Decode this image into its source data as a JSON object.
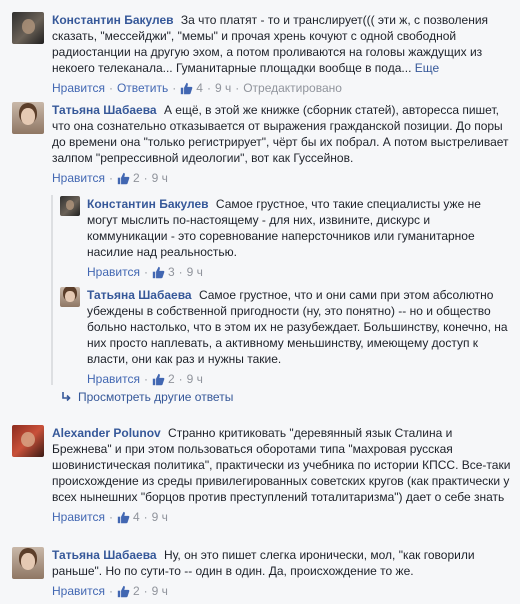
{
  "comments": [
    {
      "author": "Константин Бакулев",
      "text": "За что платят - то и транслирует((( эти ж, с позволения сказать, \"мессейджи\", \"мемы\" и прочая хрень кочуют с одной свободной радиостанции на другую эхом, а потом проливаются на головы жаждущих из некоего телеканала... Гуманитарные площадки вообще в пода...",
      "more_label": "Еще",
      "like_count": "4",
      "time": "9 ч",
      "edited": "Отредактировано"
    },
    {
      "author": "Татьяна Шабаева",
      "text": "А ещё, в этой же книжке (сборник статей), авторесса пишет, что она сознательно отказывается от выражения гражданской позиции. До поры до времени она \"только регистрирует\", чёрт бы их побрал. А потом выстреливает залпом \"репрессивной идеологии\", вот как Гуссейнов.",
      "like_count": "2",
      "time": "9 ч"
    },
    {
      "author": "Константин Бакулев",
      "text": "Самое грустное, что такие специалисты уже не могут мыслить по-настоящему - для них, извините, дискурс и коммуникации - это соревнование наперсточников или гуманитарное насилие над реальностью.",
      "like_count": "3",
      "time": "9 ч"
    },
    {
      "author": "Татьяна Шабаева",
      "text": "Самое грустное, что и они сами при этом абсолютно убеждены в собственной пригодности (ну, это понятно) -- но и общество больно настолько, что в этом их не разубеждает. Большинству, конечно, на них просто наплевать, а активному меньшинству, имеющему доступ к власти, они как раз и нужны такие.",
      "like_count": "2",
      "time": "9 ч"
    },
    {
      "author": "Alexander Polunov",
      "text": "Странно критиковать \"деревянный язык Сталина и Брежнева\" и при этом пользоваться оборотами типа \"махровая русская шовинистическая политика\", практически из учебника по истории КПСС. Все-таки происхождение из среды привилегированных советских кругов (как практически у всех нынешних \"борцов против преступлений тоталитаризма\") дает о себе знать",
      "like_count": "4",
      "time": "9 ч"
    },
    {
      "author": "Татьяна Шабаева",
      "text": "Ну, он это пишет слегка иронически, мол, \"как говорили раньше\". Но по сути-то -- один в один. Да, происхождение то же.",
      "like_count": "2",
      "time": "9 ч"
    }
  ],
  "ui": {
    "like_label": "Нравится",
    "reply_label": "Ответить",
    "show_replies": "Просмотреть другие ответы",
    "link_color": "#365899",
    "meta_color": "#90949c"
  }
}
